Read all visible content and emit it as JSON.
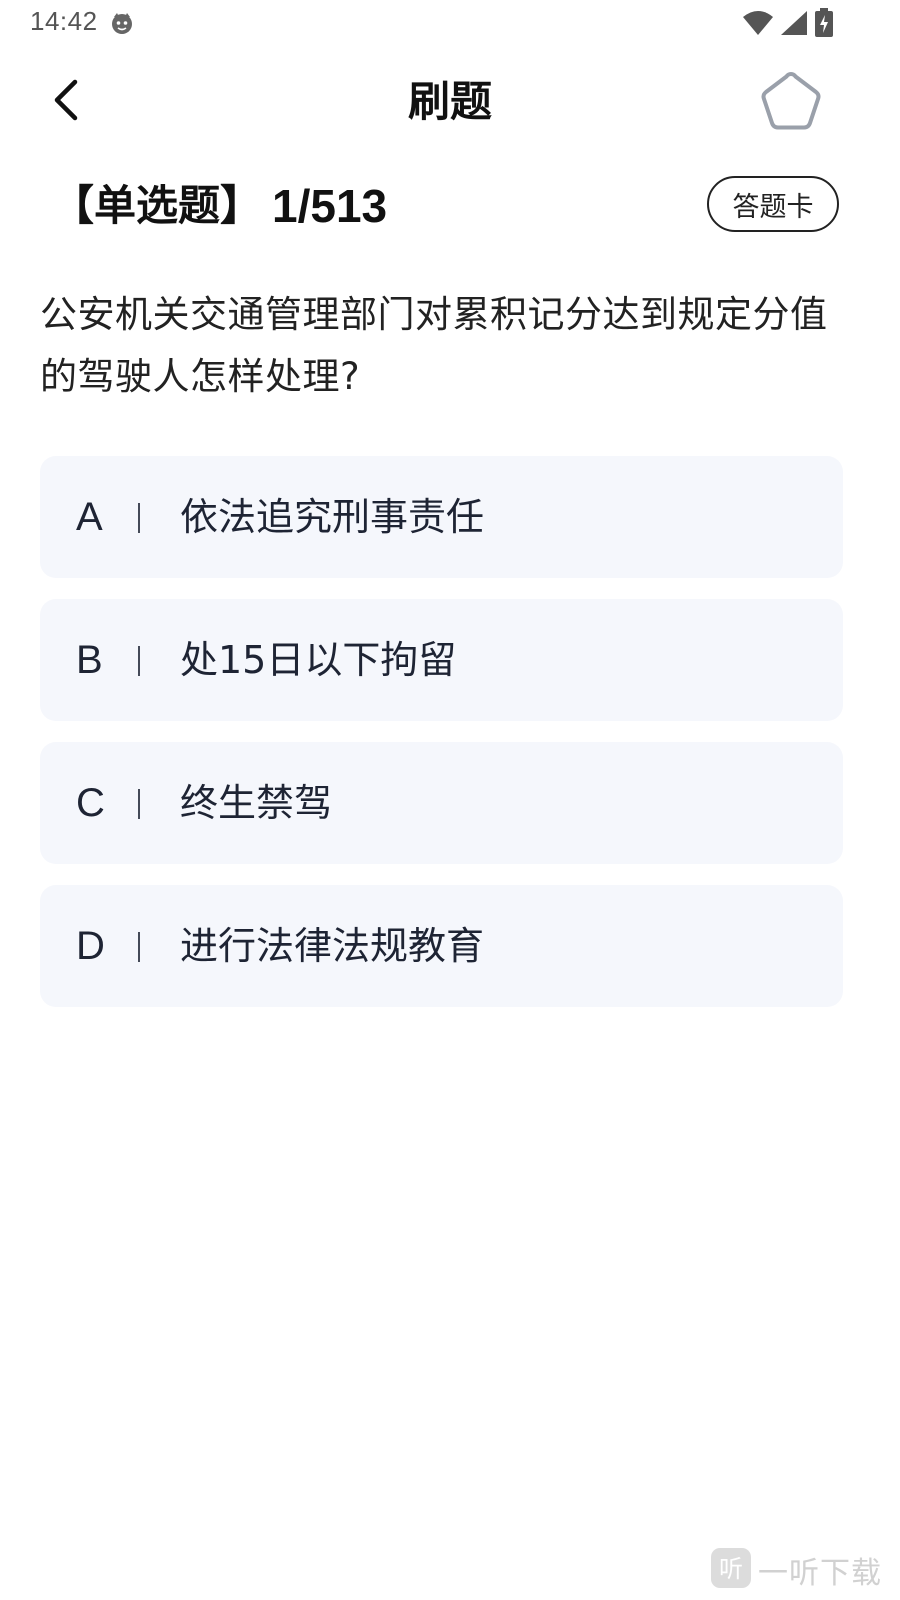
{
  "status_bar": {
    "time": "14:42",
    "app_icon": "cat-face-icon",
    "wifi_icon": "wifi-icon",
    "signal_icon": "cellular-signal-icon",
    "battery_icon": "battery-charging-icon"
  },
  "nav": {
    "title": "刷题",
    "back_icon": "chevron-left-icon",
    "favorite_icon": "star-outline-icon"
  },
  "question": {
    "type_label": "【单选题】",
    "progress": "1/513",
    "answer_card_label": "答题卡",
    "text": "公安机关交通管理部门对累积记分达到规定分值的驾驶人怎样处理?",
    "options": [
      {
        "letter": "A",
        "text": "依法追究刑事责任"
      },
      {
        "letter": "B",
        "text": "处15日以下拘留"
      },
      {
        "letter": "C",
        "text": "终生禁驾"
      },
      {
        "letter": "D",
        "text": "进行法律法规教育"
      }
    ]
  },
  "watermark": {
    "text": "一听下载",
    "logo_text": "听"
  },
  "colors": {
    "option_background": "#f5f7fc",
    "text_primary": "#111111",
    "option_text": "#1e2434"
  }
}
